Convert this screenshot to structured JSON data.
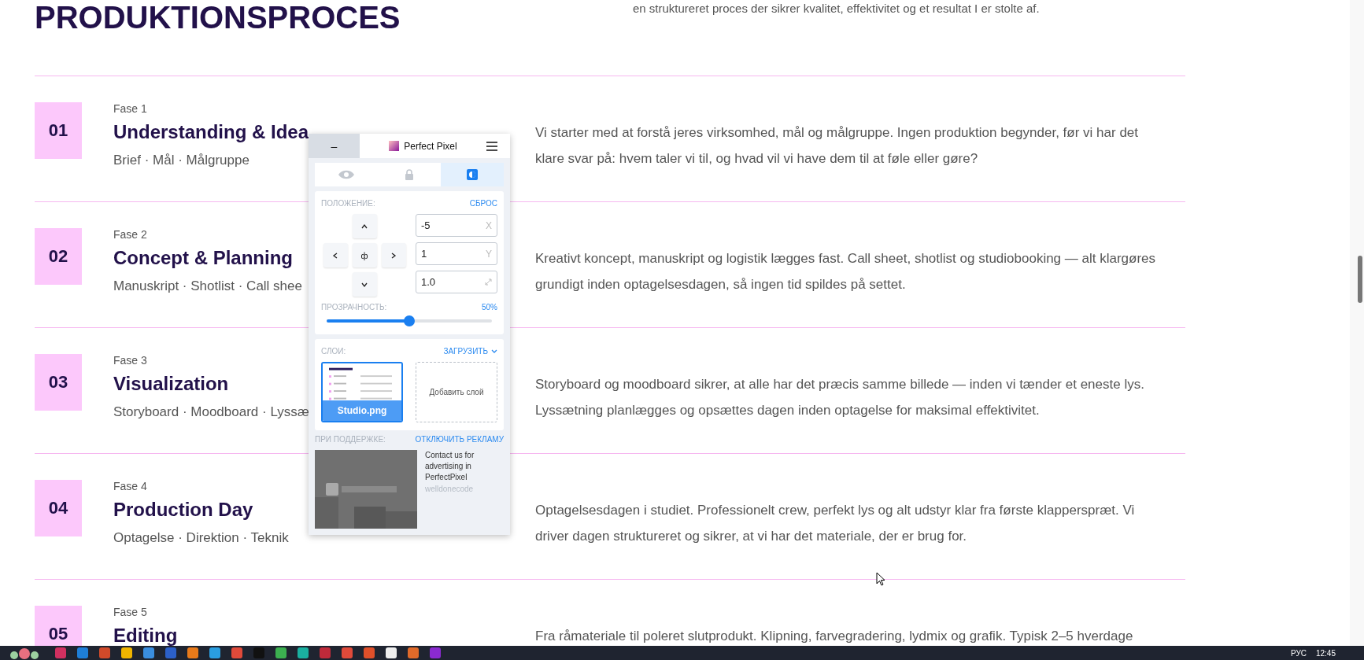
{
  "header": {
    "title": "PRODUKTIONSPROCES",
    "intro": "en struktureret proces der sikrer kvalitet, effektivitet og et resultat I er stolte af."
  },
  "phases": [
    {
      "number": "01",
      "phase": "Fase 1",
      "title": "Understanding & Idea",
      "tags": "Brief · Mål · Målgruppe",
      "description": "Vi starter med at forstå jeres virksomhed, mål og målgruppe. Ingen produktion begynder, før vi har det klare svar på: hvem taler vi til, og hvad vil vi have dem til at føle eller gøre?"
    },
    {
      "number": "02",
      "phase": "Fase 2",
      "title": "Concept & Planning",
      "tags": "Manuskript · Shotlist · Call shee",
      "description": "Kreativt koncept, manuskript og logistik lægges fast. Call sheet, shotlist og studiobooking — alt klargøres grundigt inden optagelsesdagen, så ingen tid spildes på settet."
    },
    {
      "number": "03",
      "phase": "Fase 3",
      "title": "Visualization",
      "tags": "Storyboard · Moodboard · Lyssæ",
      "description": "Storyboard og moodboard sikrer, at alle har det præcis samme billede — inden vi tænder et eneste lys. Lyssætning planlægges og opsættes dagen inden optagelse for maksimal effektivitet."
    },
    {
      "number": "04",
      "phase": "Fase 4",
      "title": "Production Day",
      "tags": "Optagelse · Direktion · Teknik",
      "description": "Optagelsesdagen i studiet. Professionelt crew, perfekt lys og alt udstyr klar fra første klapperspræt. Vi driver dagen struktureret og sikrer, at vi har det materiale, der er brug for."
    },
    {
      "number": "05",
      "phase": "Fase 5",
      "title": "Editing",
      "description": "Fra råmateriale til poleret slutprodukt. Klipning, farvegradering, lydmix og grafik. Typisk 2–5 hverdage"
    }
  ],
  "perfect_pixel": {
    "minimize": "–",
    "title": "Perfect Pixel",
    "tabs": [
      {
        "kind": "visibility",
        "selected": false
      },
      {
        "kind": "lock",
        "selected": false
      },
      {
        "kind": "contrast",
        "selected": true
      }
    ],
    "position": {
      "label": "ПОЛОЖЕНИЕ:",
      "reset": "СБРОС",
      "center": "ф",
      "fields": [
        {
          "kind": "x",
          "value": "-5",
          "suffix": "X"
        },
        {
          "kind": "y",
          "value": "1",
          "suffix": "Y"
        },
        {
          "kind": "scale",
          "value": "1.0"
        }
      ]
    },
    "opacity": {
      "label": "ПРОЗРАЧНОСТЬ:",
      "reading": "50%",
      "level": 0.5
    },
    "layers": {
      "label": "СЛОИ:",
      "upload": "ЗАГРУЗИТЬ",
      "items": [
        {
          "name": "Studio.png",
          "selected": true
        }
      ],
      "add": "Добавить слой"
    },
    "ad": {
      "label": "ПРИ ПОДДЕРЖКЕ:",
      "disable": "ОТКЛЮЧИТЬ РЕКЛАМУ",
      "text": "Contact us for advertising in PerfectPixel",
      "author": "welldonecode"
    }
  },
  "taskbar": {
    "language": "РУС",
    "time": "12:45"
  }
}
